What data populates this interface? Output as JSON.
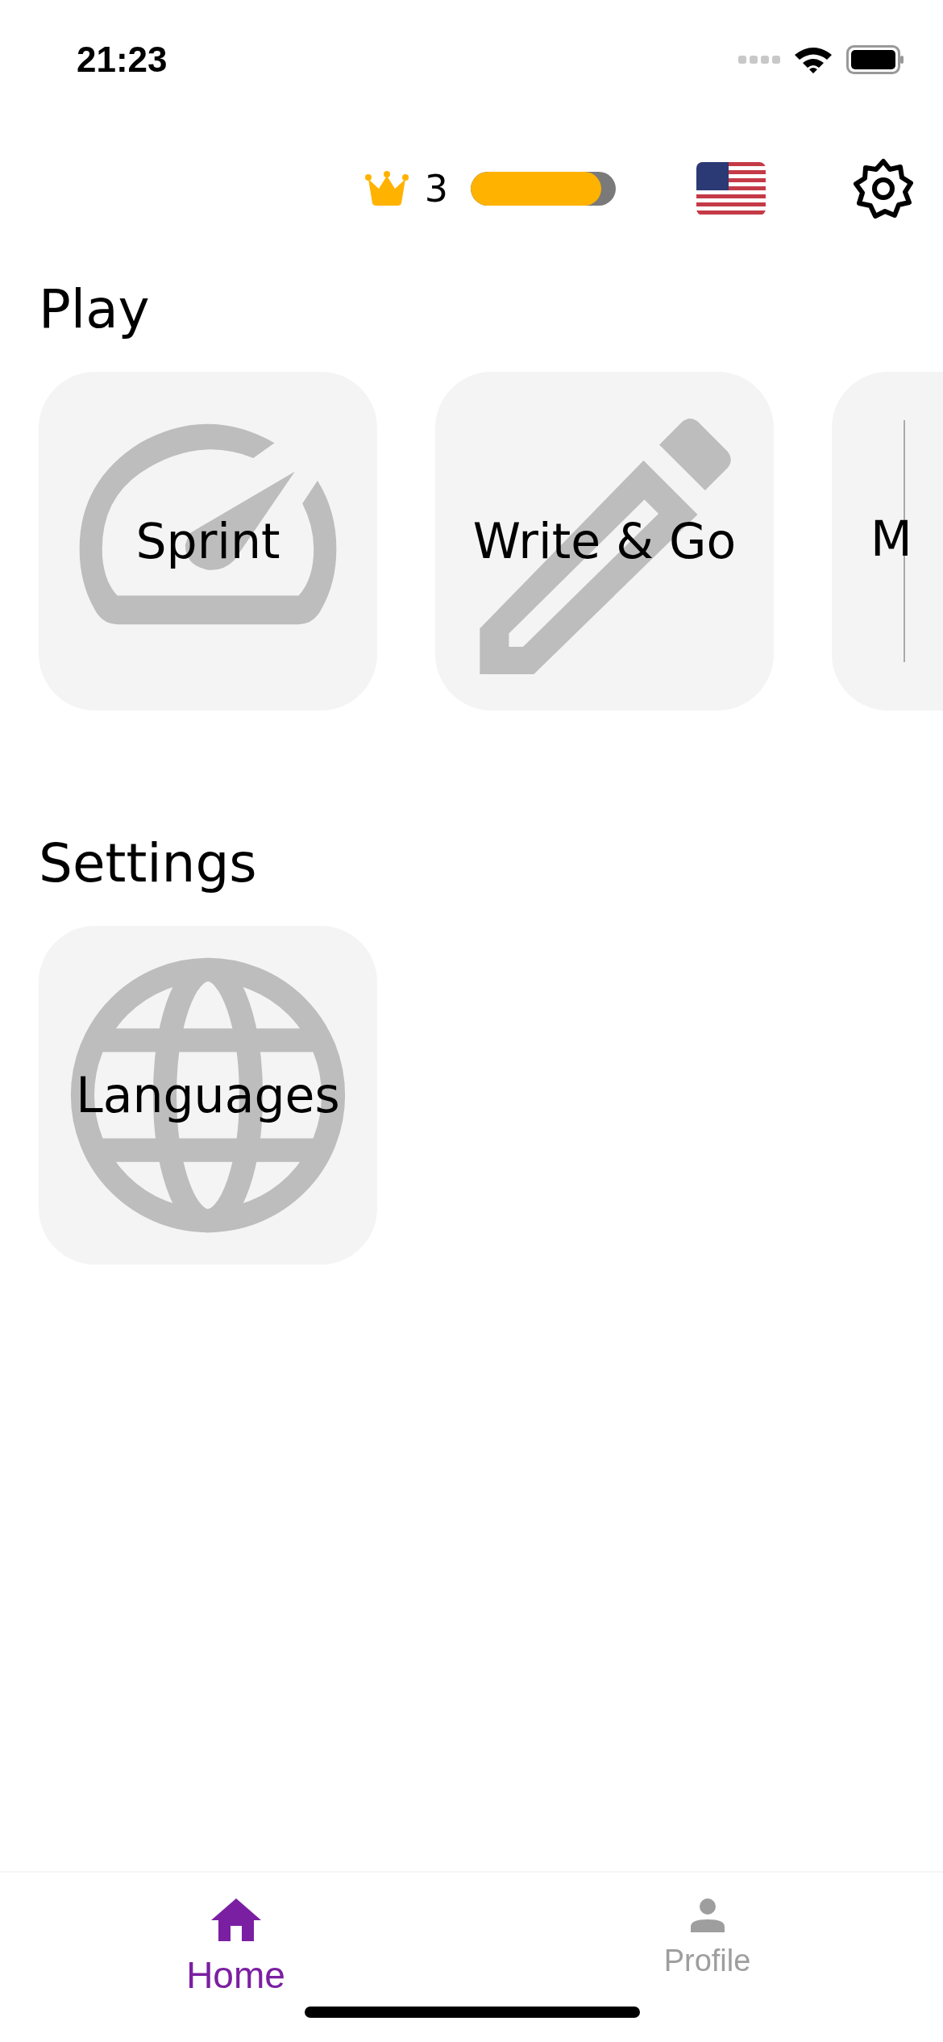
{
  "status_bar": {
    "time": "21:23"
  },
  "top_bar": {
    "crowns": "3",
    "progress": {
      "level": 0.9
    }
  },
  "sections": [
    {
      "title": "Play",
      "cards": [
        {
          "label": "Sprint",
          "kind": "speedometer"
        },
        {
          "label": "Write & Go",
          "kind": "pencil"
        },
        {
          "label": "M",
          "kind": "line"
        }
      ]
    },
    {
      "title": "Settings",
      "cards": [
        {
          "label": "Languages",
          "kind": "globe"
        }
      ]
    }
  ],
  "tabs": [
    {
      "label": "Home",
      "kind": "home",
      "selected": true
    },
    {
      "label": "Profile",
      "kind": "person",
      "selected": false
    }
  ]
}
